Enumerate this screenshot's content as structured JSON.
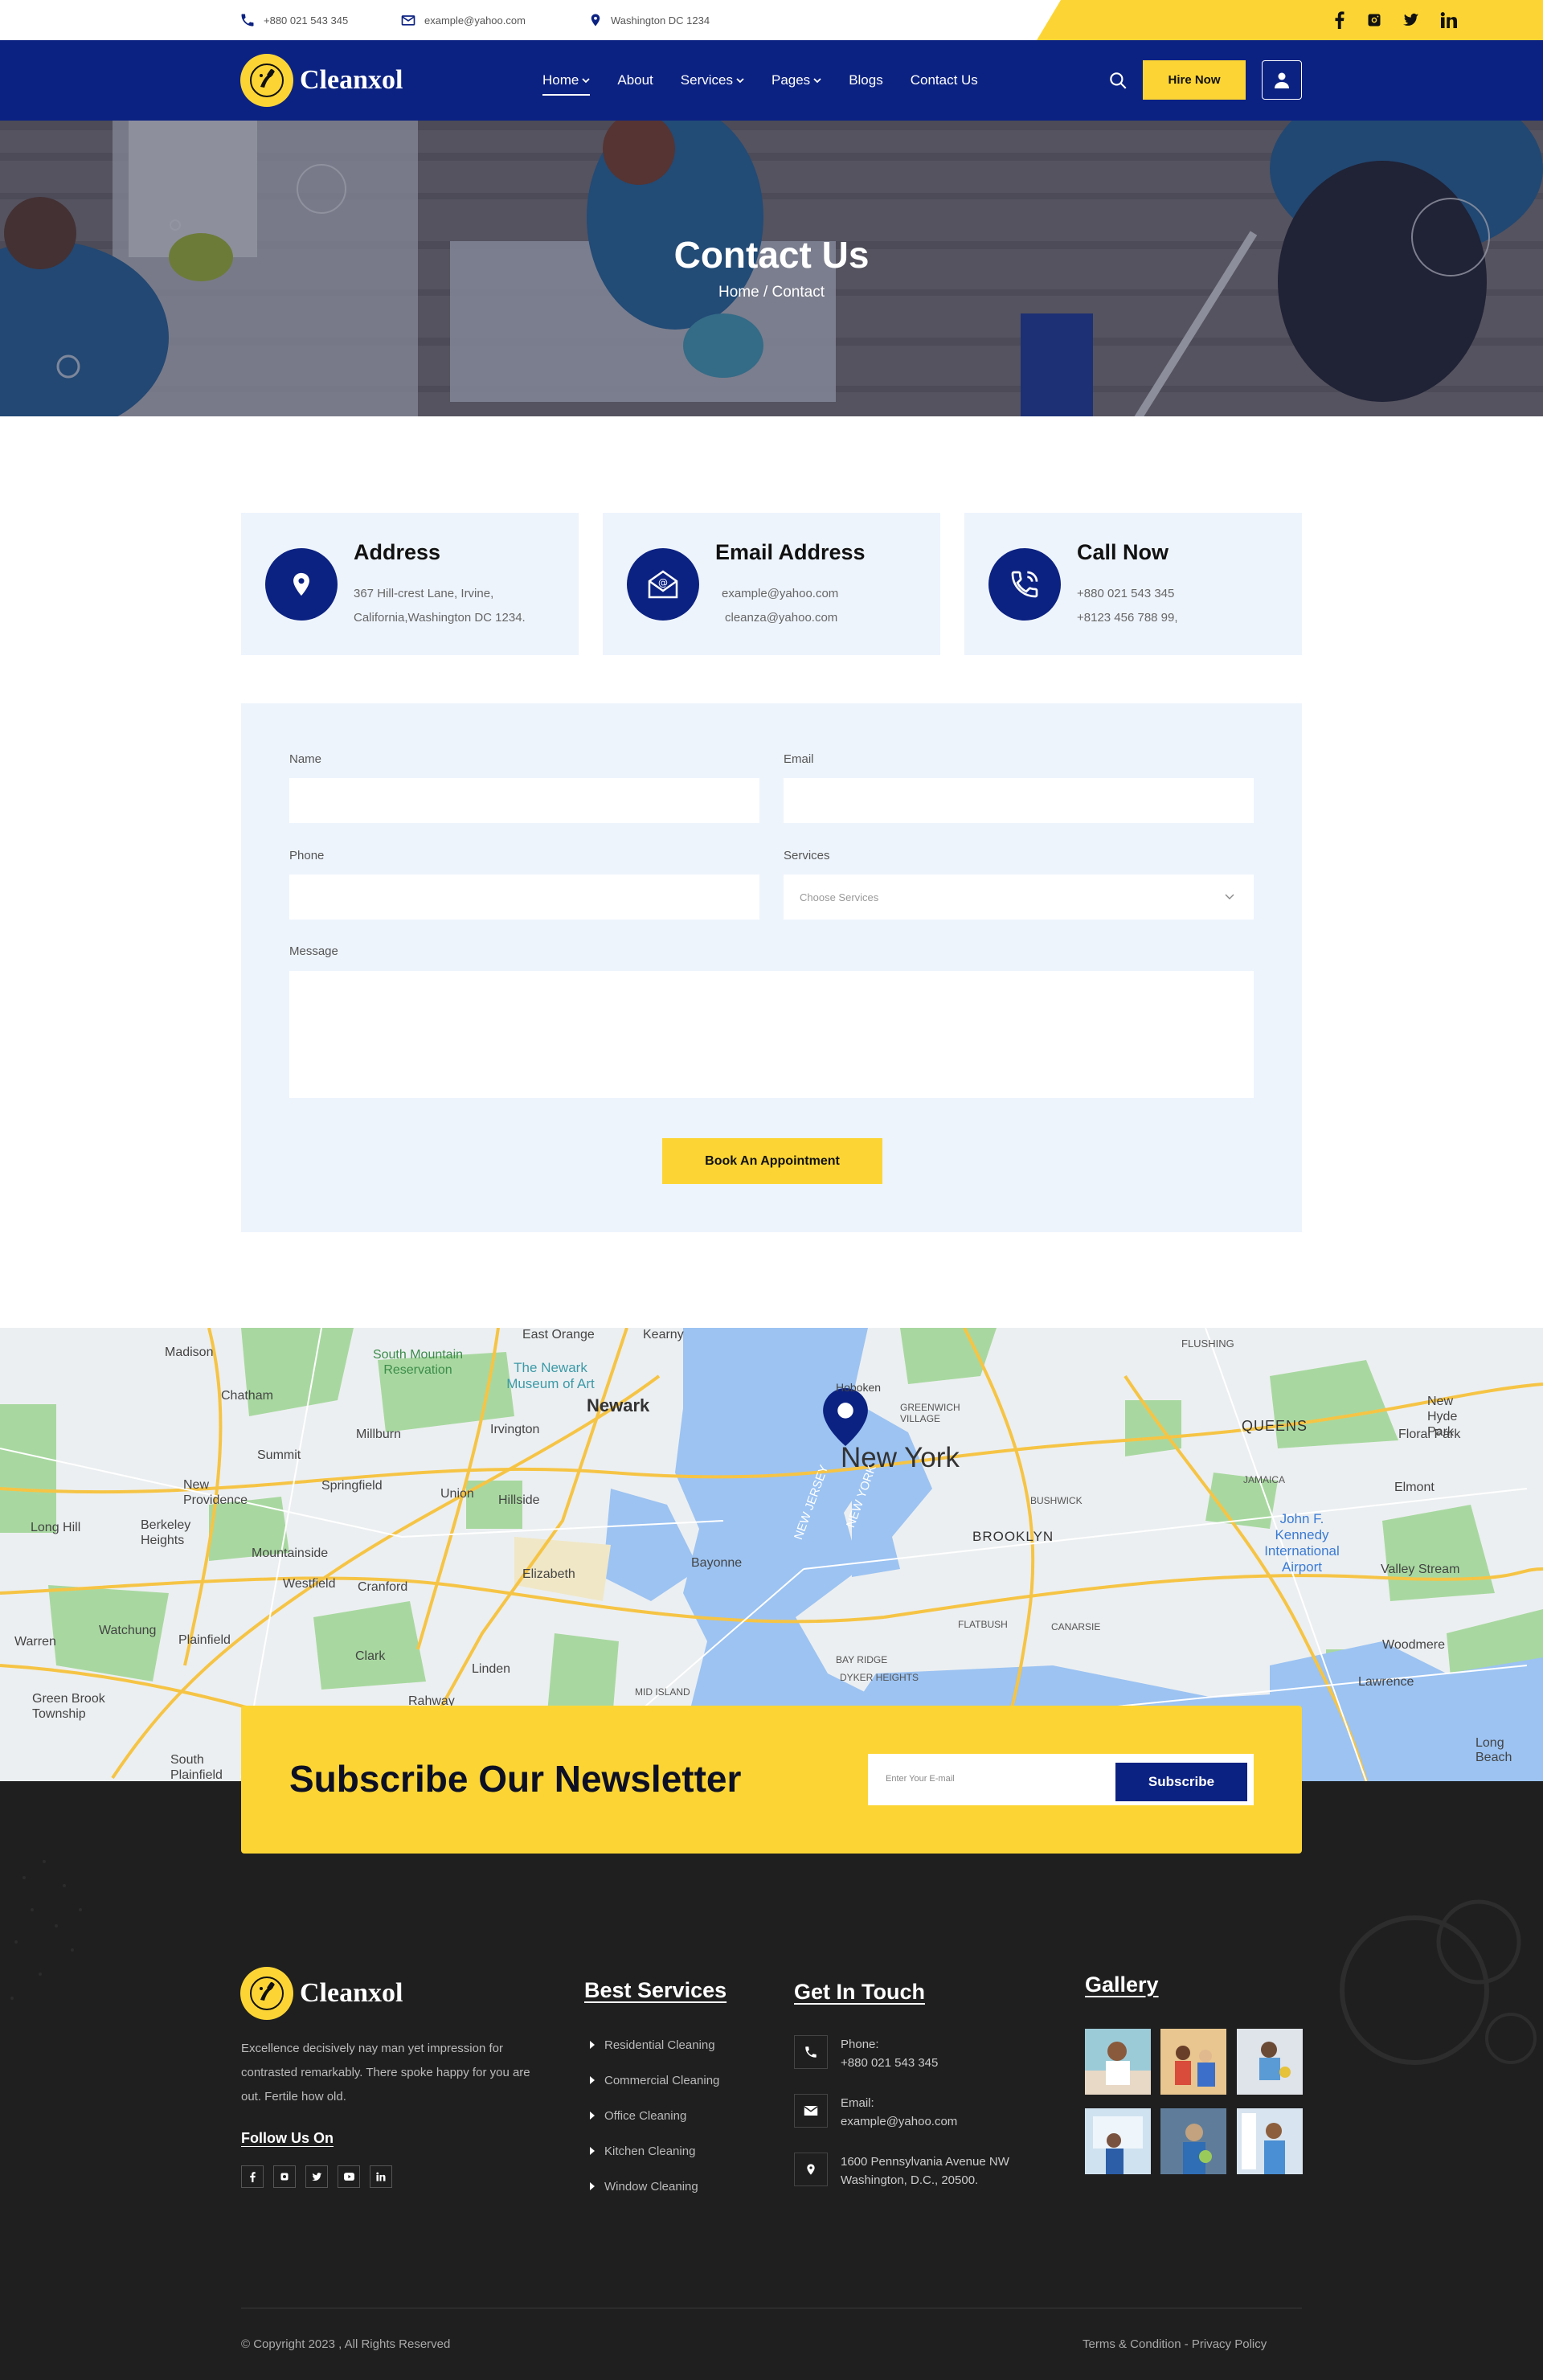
{
  "topbar": {
    "phone": "+880 021 543 345",
    "email": "example@yahoo.com",
    "location": "Washington DC 1234",
    "social_icons": [
      "facebook-icon",
      "instagram-icon",
      "twitter-icon",
      "linkedin-icon"
    ]
  },
  "brand": {
    "name": "Cleanxol",
    "accent": "#fcd535",
    "primary": "#0c2282"
  },
  "nav": {
    "items": [
      {
        "label": "Home",
        "dropdown": true,
        "active": true
      },
      {
        "label": "About",
        "dropdown": false
      },
      {
        "label": "Services",
        "dropdown": true
      },
      {
        "label": "Pages",
        "dropdown": true
      },
      {
        "label": "Blogs",
        "dropdown": false
      },
      {
        "label": "Contact Us",
        "dropdown": false
      }
    ],
    "hire_label": "Hire Now"
  },
  "hero": {
    "title": "Contact Us",
    "breadcrumb": "Home / Contact"
  },
  "info_cards": [
    {
      "title": "Address",
      "lines": [
        "367 Hill-crest Lane, Irvine,",
        "California,Washington DC 1234."
      ],
      "icon": "location-pin-icon"
    },
    {
      "title": "Email Address",
      "lines": [
        "example@yahoo.com",
        "cleanza@yahoo.com"
      ],
      "icon": "envelope-icon"
    },
    {
      "title": "Call Now",
      "lines": [
        "+880 021 543 345",
        "+8123 456 788 99,"
      ],
      "icon": "phone-icon"
    }
  ],
  "form": {
    "name_label": "Name",
    "email_label": "Email",
    "phone_label": "Phone",
    "services_label": "Services",
    "services_placeholder": "Choose Services",
    "message_label": "Message",
    "submit_label": "Book An Appointment"
  },
  "map": {
    "city": "New York",
    "labels": [
      "East Orange",
      "Kearny",
      "Madison",
      "Chatham",
      "South Mountain Reservation",
      "The Newark Museum of Art",
      "Newark",
      "Hoboken",
      "GREENWICH VILLAGE",
      "FLUSHING",
      "New Hyde Park",
      "QUEENS",
      "Floral Park",
      "Millburn",
      "Irvington",
      "Summit",
      "Springfield",
      "Union",
      "Hillside",
      "New Providence",
      "Berkeley Heights",
      "Long Hill",
      "Mountainside",
      "Westfield",
      "Cranford",
      "Elizabeth",
      "Bayonne",
      "BUSHWICK",
      "JAMAICA",
      "Elmont",
      "BROOKLYN",
      "John F. Kennedy International Airport",
      "Valley Stream",
      "Watchung",
      "Plainfield",
      "Warren",
      "Clark",
      "Linden",
      "FLATBUSH",
      "CANARSIE",
      "Woodmere",
      "BAY RIDGE",
      "DYKER HEIGHTS",
      "MID ISLAND",
      "Lawrence",
      "Green Brook Township",
      "Rahway",
      "South Plainfield",
      "Long Beach",
      "NEW JERSEY",
      "NEW YORK"
    ]
  },
  "newsletter": {
    "title": "Subscribe Our Newsletter",
    "placeholder": "Enter Your E-mail",
    "button": "Subscribe"
  },
  "footer": {
    "about": "Excellence decisively nay man yet impression for contrasted remarkably. There spoke happy for you are out. Fertile how old.",
    "follow_title": "Follow Us On",
    "services_title": "Best Services",
    "services": [
      "Residential Cleaning",
      "Commercial Cleaning",
      "Office Cleaning",
      "Kitchen Cleaning",
      "Window Cleaning"
    ],
    "touch_title": "Get In Touch",
    "contacts": [
      {
        "label": "Phone:",
        "value": "+880 021 543 345",
        "icon": "phone-icon"
      },
      {
        "label": "Email:",
        "value": "example@yahoo.com",
        "icon": "envelope-icon"
      },
      {
        "label": "1600 Pennsylvania Avenue NW",
        "value": "Washington, D.C., 20500.",
        "icon": "location-pin-icon"
      }
    ],
    "gallery_title": "Gallery",
    "copyright": "© Copyright 2023 , All Rights Reserved",
    "legal": "Terms & Condition - Privacy Policy"
  }
}
